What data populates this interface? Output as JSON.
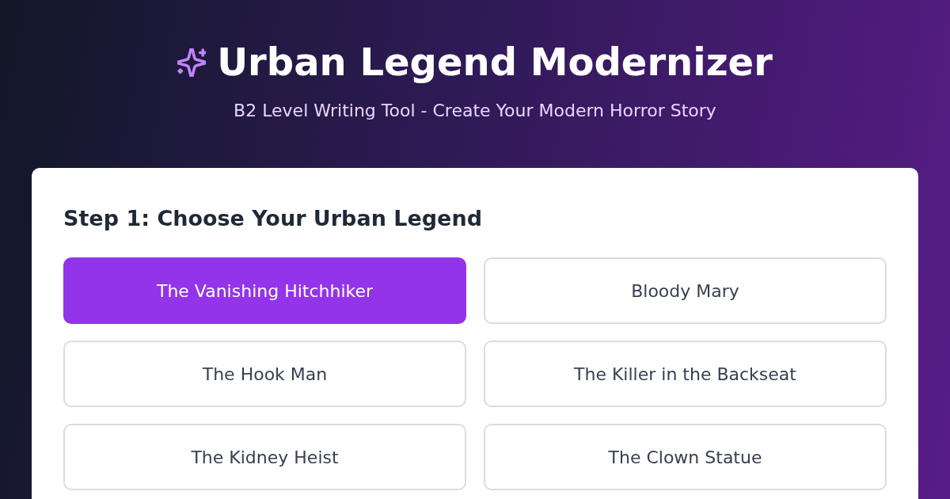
{
  "header": {
    "title": "Urban Legend Modernizer",
    "subtitle": "B2 Level Writing Tool - Create Your Modern Horror Story"
  },
  "step": {
    "heading": "Step 1: Choose Your Urban Legend",
    "options": [
      {
        "label": "The Vanishing Hitchhiker",
        "selected": true
      },
      {
        "label": "Bloody Mary",
        "selected": false
      },
      {
        "label": "The Hook Man",
        "selected": false
      },
      {
        "label": "The Killer in the Backseat",
        "selected": false
      },
      {
        "label": "The Kidney Heist",
        "selected": false
      },
      {
        "label": "The Clown Statue",
        "selected": false
      }
    ]
  }
}
